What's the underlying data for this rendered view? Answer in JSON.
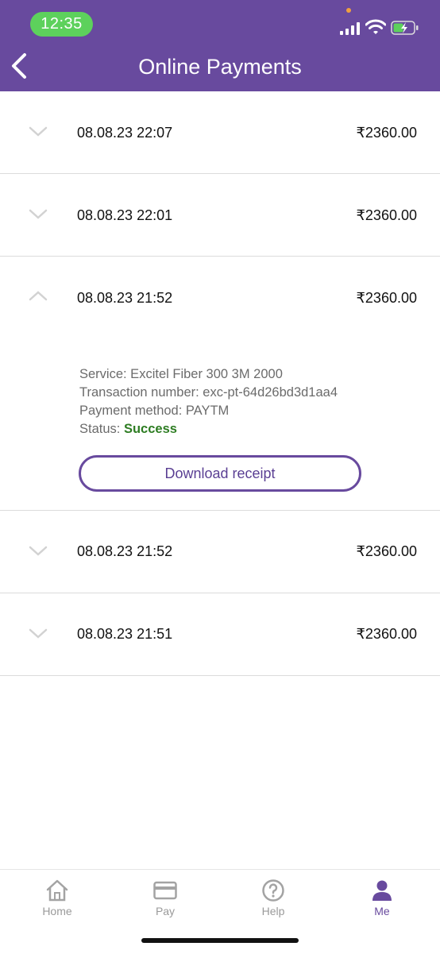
{
  "status_bar": {
    "time": "12:35"
  },
  "header": {
    "title": "Online Payments"
  },
  "payments": [
    {
      "date": "08.08.23 22:07",
      "amount": "₹2360.00"
    },
    {
      "date": "08.08.23 22:01",
      "amount": "₹2360.00"
    },
    {
      "date": "08.08.23 21:52",
      "amount": "₹2360.00",
      "expanded": true
    },
    {
      "date": "08.08.23 21:52",
      "amount": "₹2360.00"
    },
    {
      "date": "08.08.23 21:51",
      "amount": "₹2360.00"
    }
  ],
  "expanded_details": {
    "service": "Service: Excitel Fiber 300 3M 2000",
    "transaction": "Transaction number: exc-pt-64d26bd3d1aa4",
    "method": "Payment method: PAYTM",
    "status_label": "Status: ",
    "status_value": "Success",
    "download_label": "Download receipt"
  },
  "tabbar": {
    "items": [
      {
        "label": "Home",
        "icon": "home-icon"
      },
      {
        "label": "Pay",
        "icon": "card-icon"
      },
      {
        "label": "Help",
        "icon": "help-icon"
      },
      {
        "label": "Me",
        "icon": "person-icon",
        "active": true
      }
    ]
  },
  "colors": {
    "brand": "#684a9e",
    "success": "#2e7d23",
    "status_pill": "#5dd15c"
  }
}
